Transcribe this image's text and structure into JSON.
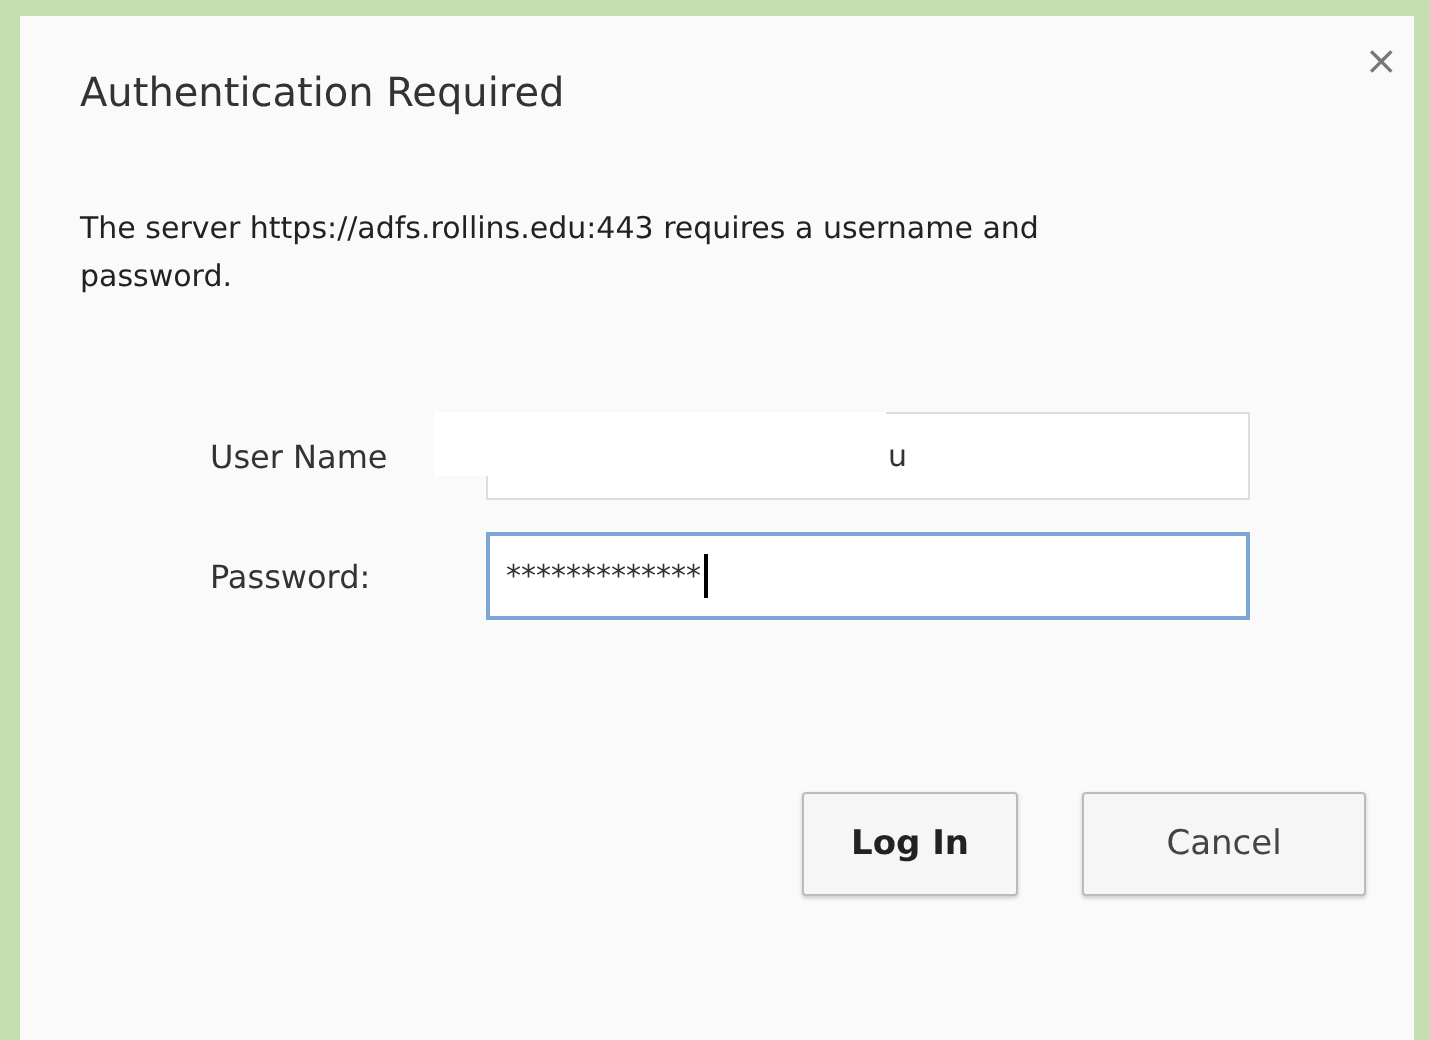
{
  "dialog": {
    "title": "Authentication Required",
    "close": "×",
    "message": "The server https://adfs.rollins.edu:443 requires a username and password."
  },
  "fields": [
    {
      "label": "User Name",
      "value": "u",
      "focused": false,
      "redacted": true
    },
    {
      "label": "Password:",
      "value": "*************",
      "focused": true,
      "redacted": false
    }
  ],
  "buttons": [
    {
      "label": "Log In",
      "default": true
    },
    {
      "label": "Cancel",
      "default": false
    }
  ]
}
